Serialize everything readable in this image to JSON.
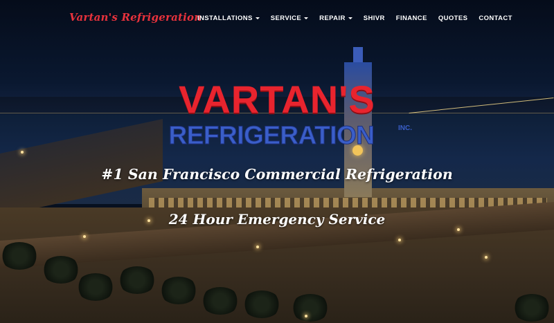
{
  "nav": {
    "brand": "Vartan's Refrigeration",
    "items": [
      {
        "label": "INSTALLATIONS",
        "dropdown": true
      },
      {
        "label": "SERVICE",
        "dropdown": true
      },
      {
        "label": "REPAIR",
        "dropdown": true
      },
      {
        "label": "SHIVR",
        "dropdown": false
      },
      {
        "label": "FINANCE",
        "dropdown": false
      },
      {
        "label": "QUOTES",
        "dropdown": false
      },
      {
        "label": "CONTACT",
        "dropdown": false
      }
    ]
  },
  "hero": {
    "logo_line1": "VARTAN'S",
    "logo_line2": "REFRIGERATION",
    "logo_inc": "INC.",
    "tagline": "#1 San Francisco Commercial Refrigeration",
    "emergency": "24 Hour Emergency Service"
  },
  "colors": {
    "brand_red": "#e8242e",
    "logo_blue": "#3a5ec9",
    "nav_text": "#ffffff",
    "night_sky": "#07101f"
  },
  "icons": {
    "dropdown": "chevron-down-icon"
  }
}
